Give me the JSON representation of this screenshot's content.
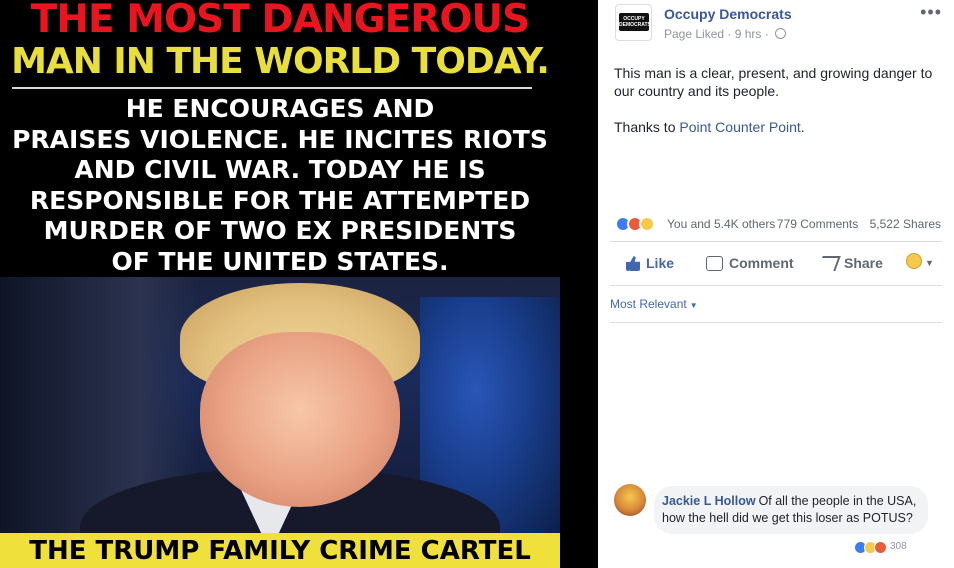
{
  "meme": {
    "headline_line1": "THE MOST DANGEROUS",
    "headline_line2": "MAN IN THE WORLD TODAY.",
    "body": "HE ENCOURAGES AND\nPRAISES VIOLENCE.  HE INCITES RIOTS\nAND CIVIL WAR.  TODAY HE IS\nRESPONSIBLE FOR THE ATTEMPTED\nMURDER OF TWO EX PRESIDENTS\nOF THE UNITED STATES.",
    "banner": "THE TRUMP FAMILY CRIME CARTEL",
    "colors": {
      "headline1": "#e8141e",
      "headline2": "#e9df3c",
      "banner_bg": "#efe03c"
    }
  },
  "post": {
    "page_name": "Occupy Democrats",
    "avatar_text": "OCCUPY DEMOCRATS",
    "meta": "Page Liked · 9 hrs ·",
    "more_label": "•••",
    "text_line1": "This man is a clear, present, and growing danger to our country and its people.",
    "thanks_prefix": "Thanks to ",
    "thanks_link": "Point Counter Point",
    "thanks_suffix": "."
  },
  "reactions": {
    "names": "You and 5.4K others",
    "comments": "779 Comments",
    "shares": "5,522 Shares",
    "icons": [
      "like-icon",
      "angry-icon",
      "sad-icon"
    ]
  },
  "actions": {
    "like": "Like",
    "comment": "Comment",
    "share": "Share"
  },
  "sort": {
    "label": "Most Relevant"
  },
  "comment": {
    "author": "Jackie L Hollow",
    "text": "Of all the people in the USA, how the hell did we get this loser as POTUS?",
    "reaction_count": "308"
  }
}
